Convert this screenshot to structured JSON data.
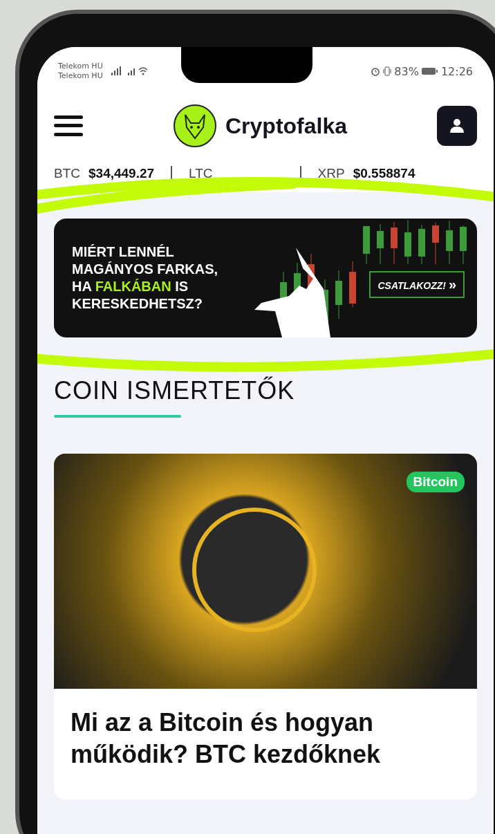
{
  "status_bar": {
    "carriers": [
      "Telekom HU",
      "Telekom HU"
    ],
    "battery": "83%",
    "time": "12:26"
  },
  "header": {
    "brand": "Cryptofalka"
  },
  "ticker": [
    {
      "symbol": "BTC",
      "price": "$34,449.27"
    },
    {
      "symbol": "LTC"
    },
    {
      "symbol": "XRP",
      "price": "$0.558874"
    }
  ],
  "banner": {
    "headline": [
      {
        "parts": [
          {
            "text": "MIÉRT LENNÉL",
            "highlight": false
          }
        ]
      },
      {
        "parts": [
          {
            "text": "MAGÁNYOS FARKAS,",
            "highlight": false
          }
        ]
      },
      {
        "parts": [
          {
            "text": "HA ",
            "highlight": false
          },
          {
            "text": "FALKÁBAN",
            "highlight": true
          },
          {
            "text": " IS",
            "highlight": false
          }
        ]
      },
      {
        "parts": [
          {
            "text": "KERESKEDHETSZ?",
            "highlight": false
          }
        ]
      }
    ],
    "button": "CSATLAKOZZ!",
    "button_icon": "»"
  },
  "section": {
    "title": "COIN ISMERTETŐK"
  },
  "article": {
    "tag": "Bitcoin",
    "title": "Mi az a Bitcoin és hogyan működik? BTC kezdőknek"
  }
}
